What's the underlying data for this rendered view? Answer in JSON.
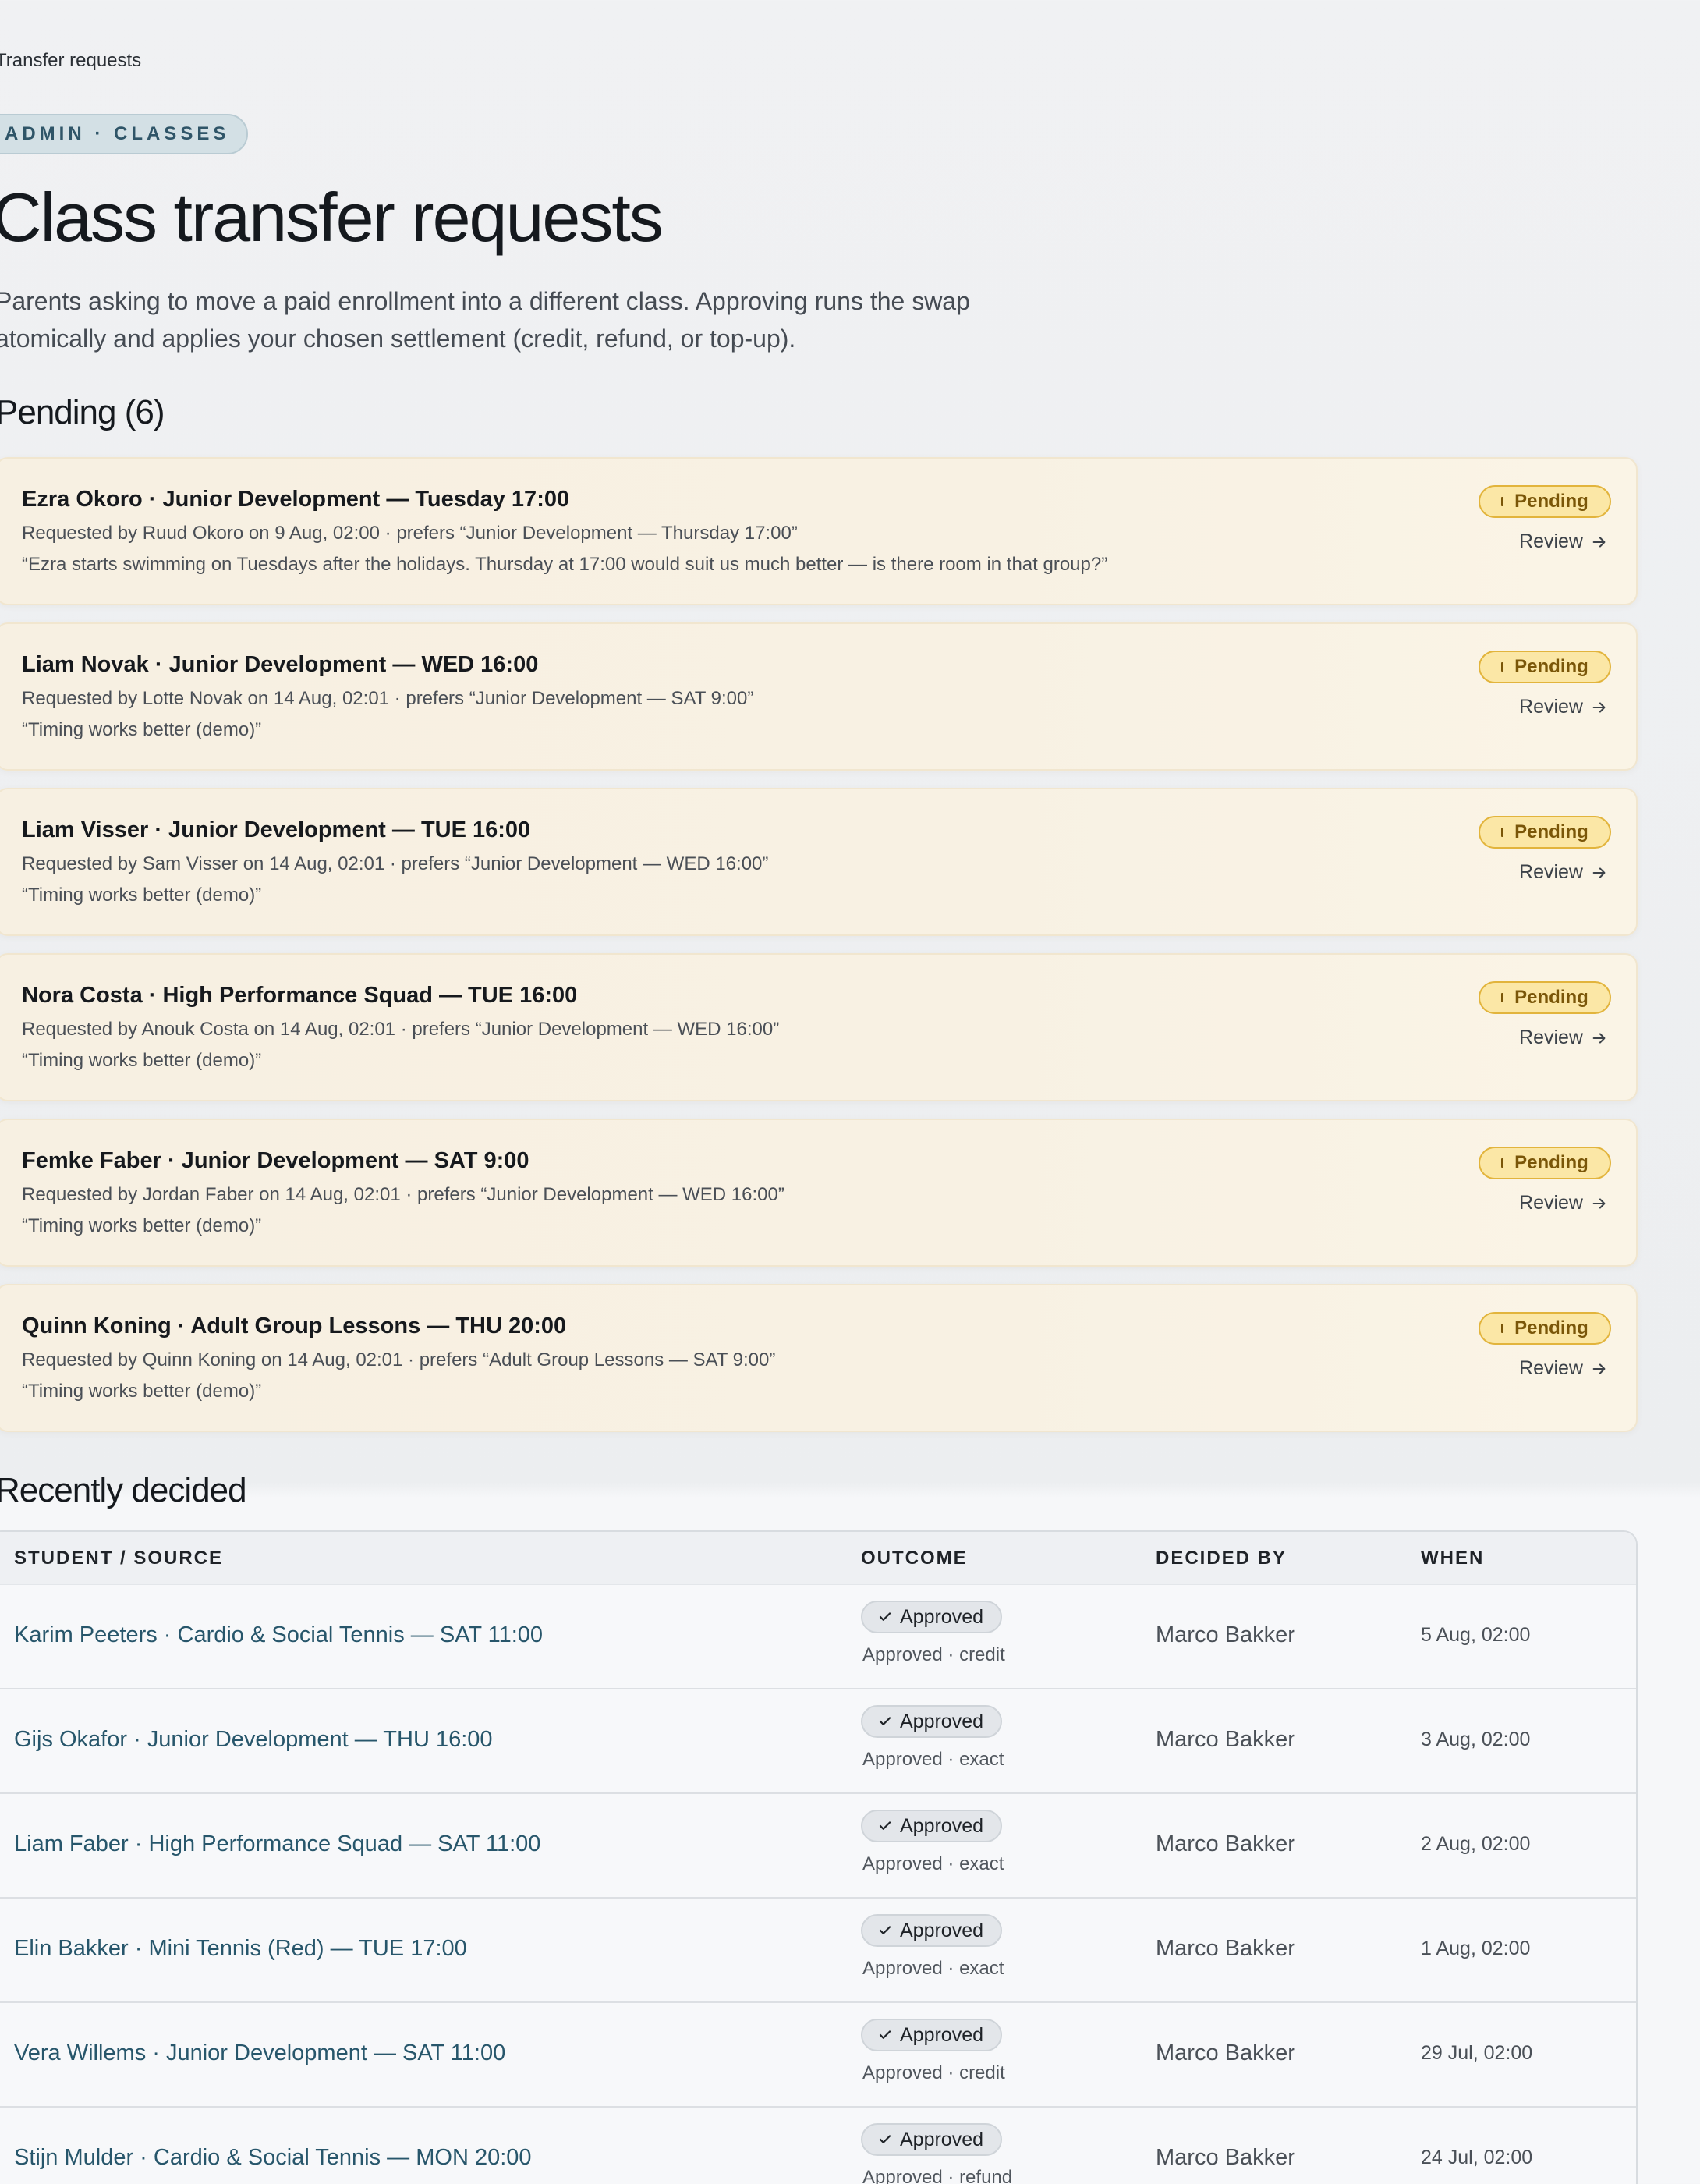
{
  "breadcrumb": "Transfer requests",
  "eyebrow": "ADMIN · CLASSES",
  "title": "Class transfer requests",
  "intro": "Parents asking to move a paid enrollment into a different class. Approving runs the swap atomically and applies your chosen settlement (credit, refund, or top-up).",
  "pending_heading": "Pending (6)",
  "pending": [
    {
      "title": "Ezra Okoro · Junior Development — Tuesday 17:00",
      "meta": "Requested by Ruud Okoro on 9 Aug, 02:00 · prefers “Junior Development — Thursday 17:00”",
      "note": "“Ezra starts swimming on Tuesdays after the holidays. Thursday at 17:00 would suit us much better — is there room in that group?”",
      "status": "Pending",
      "action": "Review"
    },
    {
      "title": "Liam Novak · Junior Development — WED 16:00",
      "meta": "Requested by Lotte Novak on 14 Aug, 02:01 · prefers “Junior Development — SAT 9:00”",
      "note": "“Timing works better (demo)”",
      "status": "Pending",
      "action": "Review"
    },
    {
      "title": "Liam Visser · Junior Development — TUE 16:00",
      "meta": "Requested by Sam Visser on 14 Aug, 02:01 · prefers “Junior Development — WED 16:00”",
      "note": "“Timing works better (demo)”",
      "status": "Pending",
      "action": "Review"
    },
    {
      "title": "Nora Costa · High Performance Squad — TUE 16:00",
      "meta": "Requested by Anouk Costa on 14 Aug, 02:01 · prefers “Junior Development — WED 16:00”",
      "note": "“Timing works better (demo)”",
      "status": "Pending",
      "action": "Review"
    },
    {
      "title": "Femke Faber · Junior Development — SAT 9:00",
      "meta": "Requested by Jordan Faber on 14 Aug, 02:01 · prefers “Junior Development — WED 16:00”",
      "note": "“Timing works better (demo)”",
      "status": "Pending",
      "action": "Review"
    },
    {
      "title": "Quinn Koning · Adult Group Lessons — THU 20:00",
      "meta": "Requested by Quinn Koning on 14 Aug, 02:01 · prefers “Adult Group Lessons — SAT 9:00”",
      "note": "“Timing works better (demo)”",
      "status": "Pending",
      "action": "Review"
    }
  ],
  "decided_heading": "Recently decided",
  "table": {
    "headers": {
      "source": "STUDENT / SOURCE",
      "outcome": "OUTCOME",
      "decided_by": "DECIDED BY",
      "when": "WHEN"
    },
    "rows": [
      {
        "source": "Karim Peeters · Cardio & Social Tennis — SAT 11:00",
        "status": "Approved",
        "detail": "Approved · credit",
        "decided_by": "Marco Bakker",
        "when": "5 Aug, 02:00"
      },
      {
        "source": "Gijs Okafor · Junior Development — THU 16:00",
        "status": "Approved",
        "detail": "Approved · exact",
        "decided_by": "Marco Bakker",
        "when": "3 Aug, 02:00"
      },
      {
        "source": "Liam Faber · High Performance Squad — SAT 11:00",
        "status": "Approved",
        "detail": "Approved · exact",
        "decided_by": "Marco Bakker",
        "when": "2 Aug, 02:00"
      },
      {
        "source": "Elin Bakker · Mini Tennis (Red) — TUE 17:00",
        "status": "Approved",
        "detail": "Approved · exact",
        "decided_by": "Marco Bakker",
        "when": "1 Aug, 02:00"
      },
      {
        "source": "Vera Willems · Junior Development — SAT 11:00",
        "status": "Approved",
        "detail": "Approved · credit",
        "decided_by": "Marco Bakker",
        "when": "29 Jul, 02:00"
      },
      {
        "source": "Stijn Mulder · Cardio & Social Tennis — MON 20:00",
        "status": "Approved",
        "detail": "Approved · refund",
        "decided_by": "Marco Bakker",
        "when": "24 Jul, 02:00"
      }
    ]
  }
}
